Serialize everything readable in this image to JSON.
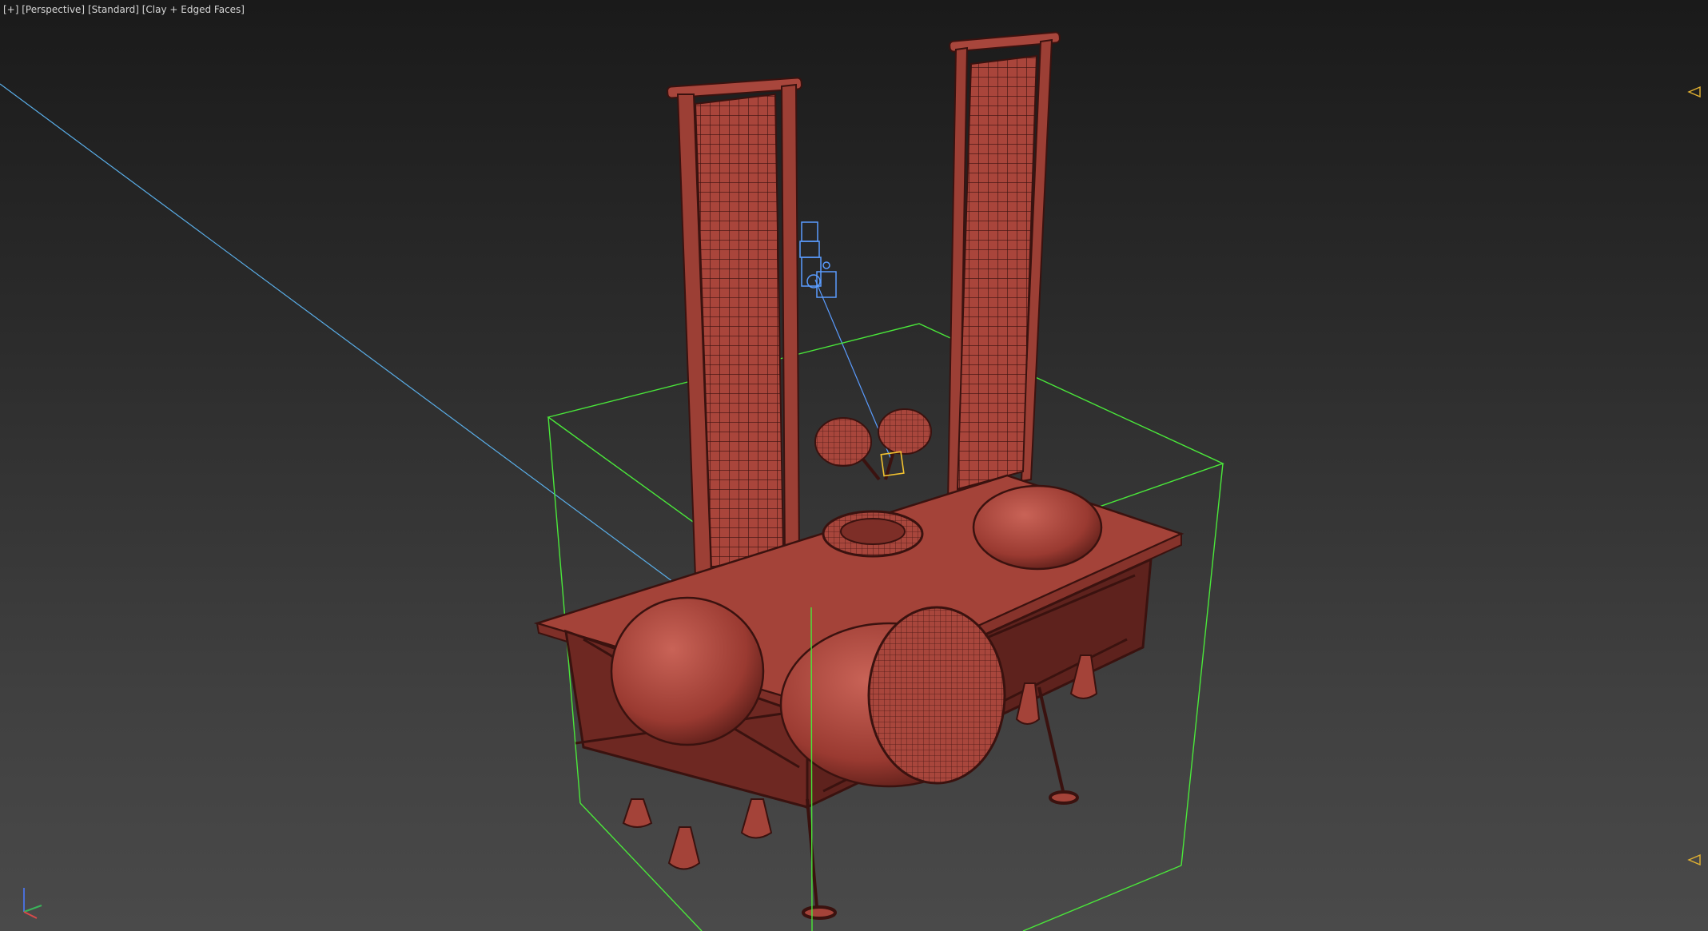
{
  "viewport": {
    "label": {
      "plus": "[+]",
      "view": "[Perspective]",
      "shading_preset": "[Standard]",
      "display_mode": "[Clay + Edged Faces]"
    },
    "colors": {
      "model": "#b14a40",
      "model_dark": "#3a120f",
      "bounding_box": "#4ae83a",
      "selection": "#5a9cff",
      "target": "#f2c230",
      "range_marker": "#e3b231"
    },
    "icons": [
      "triangle-marker-icon",
      "axis-tripod-icon",
      "camera-helper-icon"
    ]
  }
}
